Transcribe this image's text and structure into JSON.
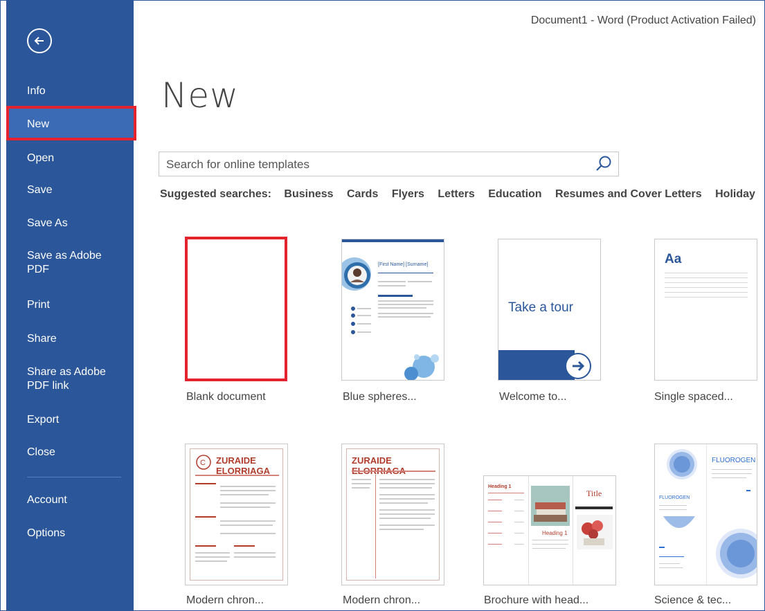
{
  "window": {
    "title": "Document1 - Word (Product Activation Failed)"
  },
  "sidebar": {
    "items": [
      {
        "label": "Info"
      },
      {
        "label": "New"
      },
      {
        "label": "Open"
      },
      {
        "label": "Save"
      },
      {
        "label": "Save As"
      },
      {
        "label": "Save as Adobe PDF"
      },
      {
        "label": "Print"
      },
      {
        "label": "Share"
      },
      {
        "label": "Share as Adobe PDF link"
      },
      {
        "label": "Export"
      },
      {
        "label": "Close"
      },
      {
        "label": "Account"
      },
      {
        "label": "Options"
      }
    ],
    "selected": "New"
  },
  "main": {
    "title": "New",
    "search": {
      "placeholder": "Search for online templates"
    },
    "suggested": {
      "label": "Suggested searches:",
      "links": [
        "Business",
        "Cards",
        "Flyers",
        "Letters",
        "Education",
        "Resumes and Cover Letters",
        "Holiday"
      ]
    },
    "templates": [
      {
        "label": "Blank document"
      },
      {
        "label": "Blue spheres..."
      },
      {
        "label": "Welcome to..."
      },
      {
        "label": "Single spaced..."
      },
      {
        "label": "Modern chron..."
      },
      {
        "label": "Modern chron..."
      },
      {
        "label": "Brochure with head..."
      },
      {
        "label": "Science & tec..."
      }
    ],
    "thumb_text": {
      "tour": "Take a tour",
      "aa": "Aa",
      "resume_name": "ZURAIDE ELORRIAGA",
      "blue_name": "[First Name] [Surname]",
      "title_word": "Title",
      "heading": "Heading 1",
      "fluorogen": "FLUOROGEN"
    }
  },
  "colors": {
    "sidebar": "#2b579a",
    "highlight": "#e4232f",
    "selected_bg": "#3c6bb5"
  }
}
